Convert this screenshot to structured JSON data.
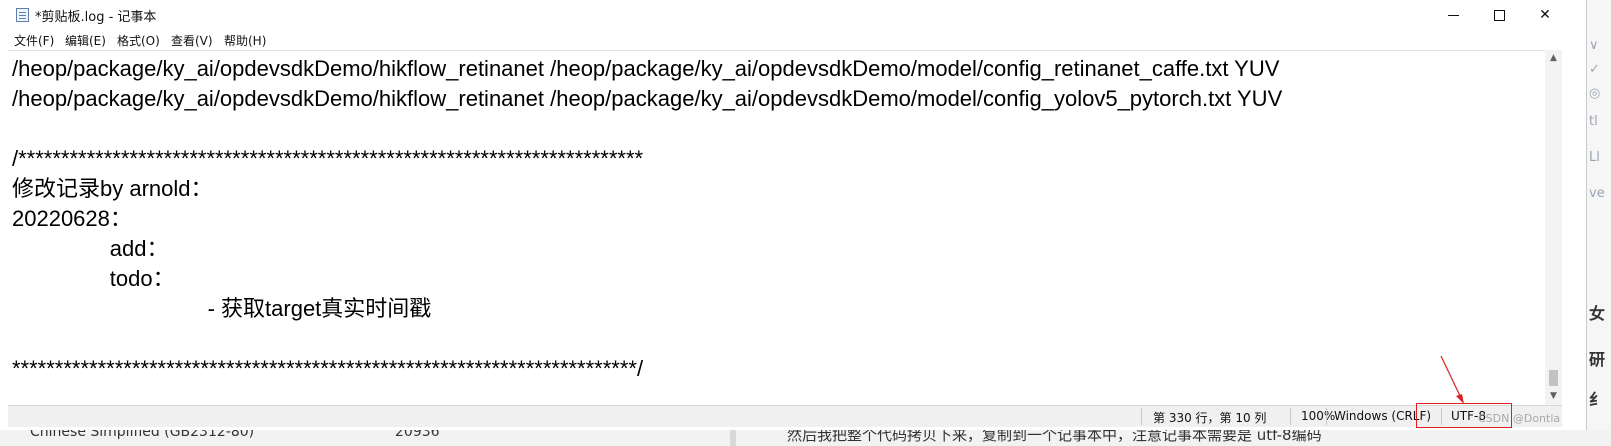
{
  "window": {
    "title": "*剪贴板.log - 记事本",
    "controls": {
      "minimize": "minimize",
      "maximize": "maximize",
      "close": "✕"
    }
  },
  "menu": {
    "items": [
      {
        "label": "文件(F)"
      },
      {
        "label": "编辑(E)"
      },
      {
        "label": "格式(O)"
      },
      {
        "label": "查看(V)"
      },
      {
        "label": "帮助(H)"
      }
    ]
  },
  "editor": {
    "content": "/heop/package/ky_ai/opdevsdkDemo/hikflow_retinanet /heop/package/ky_ai/opdevsdkDemo/model/config_retinanet_caffe.txt YUV\n/heop/package/ky_ai/opdevsdkDemo/hikflow_retinanet /heop/package/ky_ai/opdevsdkDemo/model/config_yolov5_pytorch.txt YUV\n\n/*************************************************************************\n修改记录by arnold：\n20220628：\n                add：\n                todo：\n                                - 获取target真实时间戳\n\n*************************************************************************/"
  },
  "statusbar": {
    "position": "第 330 行，第 10 列",
    "zoom": "100%",
    "line_ending": "Windows (CRLF)",
    "encoding": "UTF-8"
  },
  "annotation": {
    "color": "#e02020",
    "watermark": "CSDN @Dontla"
  },
  "background": {
    "bottom_left": "Chinese Simplified (GB2312-80)",
    "bottom_mid": "20936",
    "bottom_right": "然后我把整个代码拷贝下来，复制到一个记事本中，注意记事本需要是 utf-8编码",
    "right_fragments": [
      "∨",
      "✓",
      "◎",
      "tl",
      "Ll",
      "ve",
      "女",
      "研",
      "纟"
    ]
  }
}
